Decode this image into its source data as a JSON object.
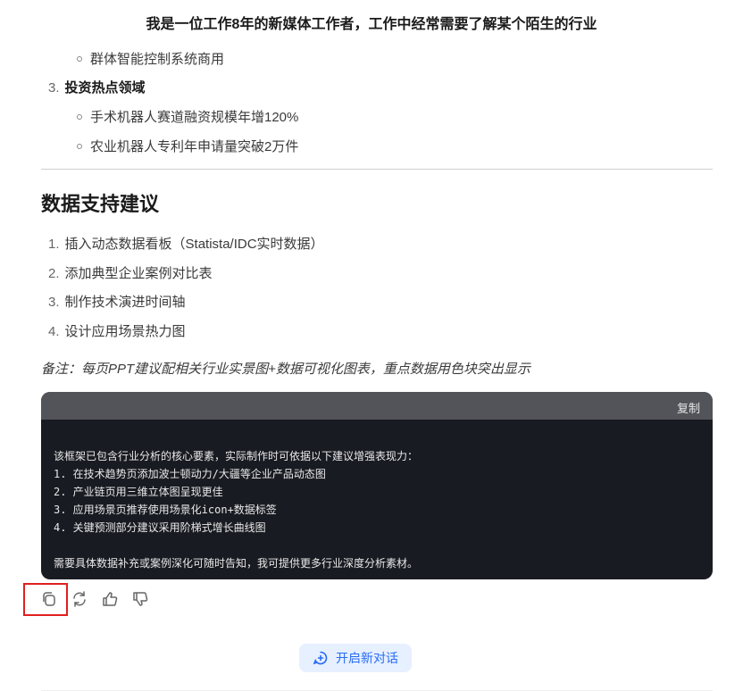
{
  "header": {
    "title": "我是一位工作8年的新媒体工作者，工作中经常需要了解某个陌生的行业"
  },
  "content": {
    "prev_sub_item": "群体智能控制系统商用",
    "section3": {
      "num": "3.",
      "label": "投资热点领域",
      "items": [
        "手术机器人赛道融资规模年增120%",
        "农业机器人专利年申请量突破2万件"
      ]
    },
    "data_support": {
      "heading": "数据支持建议",
      "items": [
        {
          "num": "1.",
          "text": "插入动态数据看板（Statista/IDC实时数据）"
        },
        {
          "num": "2.",
          "text": "添加典型企业案例对比表"
        },
        {
          "num": "3.",
          "text": "制作技术演进时间轴"
        },
        {
          "num": "4.",
          "text": "设计应用场景热力图"
        }
      ]
    },
    "note": "备注：每页PPT建议配相关行业实景图+数据可视化图表，重点数据用色块突出显示"
  },
  "code_block": {
    "copy_label": "复制",
    "lines": [
      "该框架已包含行业分析的核心要素，实际制作时可依据以下建议增强表现力：",
      "1. 在技术趋势页添加波士顿动力/大疆等企业产品动态图",
      "2. 产业链页用三维立体图呈现更佳",
      "3. 应用场景页推荐使用场景化icon+数据标签",
      "4. 关键预测部分建议采用阶梯式增长曲线图",
      "",
      "需要具体数据补充或案例深化可随时告知，我可提供更多行业深度分析素材。"
    ]
  },
  "actions": {
    "icons": [
      "copy-icon",
      "regenerate-icon",
      "thumbs-up-icon",
      "thumbs-down-icon"
    ]
  },
  "new_chat": {
    "label": "开启新对话"
  },
  "colors": {
    "accent": "#2a6cf6",
    "highlight": "#e02020",
    "code_bg": "#191b22"
  }
}
